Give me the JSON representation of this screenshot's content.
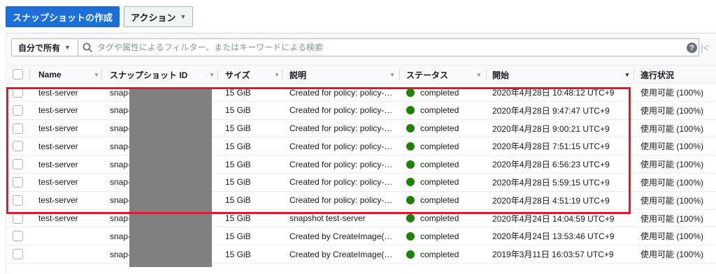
{
  "toolbar": {
    "create_label": "スナップショットの作成",
    "actions_label": "アクション"
  },
  "filter": {
    "owner_label": "自分で所有",
    "placeholder": "タグや属性によるフィルター、またはキーワードによる検索",
    "help_glyph": "?",
    "pager_glyph": "|<"
  },
  "table": {
    "headers": {
      "name": "Name",
      "snapshot_id": "スナップショット ID",
      "size": "サイズ",
      "description": "説明",
      "status": "ステータス",
      "started": "開始",
      "progress": "進行状況"
    },
    "rows": [
      {
        "name": "test-server",
        "snapshot_id": "snap-0",
        "size": "15 GiB",
        "description": "Created for policy: policy-…",
        "status": "completed",
        "started": "2020年4月28日 10:48:12 UTC+9",
        "progress": "使用可能 (100%)"
      },
      {
        "name": "test-server",
        "snapshot_id": "snap-0",
        "size": "15 GiB",
        "description": "Created for policy: policy-…",
        "status": "completed",
        "started": "2020年4月28日 9:47:47 UTC+9",
        "progress": "使用可能 (100%)"
      },
      {
        "name": "test-server",
        "snapshot_id": "snap-0",
        "size": "15 GiB",
        "description": "Created for policy: policy-…",
        "status": "completed",
        "started": "2020年4月28日 9:00:21 UTC+9",
        "progress": "使用可能 (100%)"
      },
      {
        "name": "test-server",
        "snapshot_id": "snap-0",
        "size": "15 GiB",
        "description": "Created for policy: policy-…",
        "status": "completed",
        "started": "2020年4月28日 7:51:15 UTC+9",
        "progress": "使用可能 (100%)"
      },
      {
        "name": "test-server",
        "snapshot_id": "snap-0",
        "size": "15 GiB",
        "description": "Created for policy: policy-…",
        "status": "completed",
        "started": "2020年4月28日 6:56:23 UTC+9",
        "progress": "使用可能 (100%)"
      },
      {
        "name": "test-server",
        "snapshot_id": "snap-0",
        "size": "15 GiB",
        "description": "Created for policy: policy-…",
        "status": "completed",
        "started": "2020年4月28日 5:59:15 UTC+9",
        "progress": "使用可能 (100%)"
      },
      {
        "name": "test-server",
        "snapshot_id": "snap-0",
        "size": "15 GiB",
        "description": "Created for policy: policy-…",
        "status": "completed",
        "started": "2020年4月28日 4:51:19 UTC+9",
        "progress": "使用可能 (100%)"
      },
      {
        "name": "test-server",
        "snapshot_id": "snap-0",
        "size": "15 GiB",
        "description": "snapshot test-server",
        "status": "completed",
        "started": "2020年4月24日 14:04:59 UTC+9",
        "progress": "使用可能 (100%)"
      },
      {
        "name": "",
        "snapshot_id": "snap-0",
        "size": "15 GiB",
        "description": "Created by CreateImage(…",
        "status": "completed",
        "started": "2020年4月24日 13:53:46 UTC+9",
        "progress": "使用可能 (100%)"
      },
      {
        "name": "",
        "snapshot_id": "snap-0",
        "size": "15 GiB",
        "description": "Created by CreateImage(…",
        "status": "completed",
        "started": "2019年3月11日 16:03:57 UTC+9",
        "progress": "使用可能 (100%)"
      }
    ]
  },
  "colors": {
    "primary": "#1e6fd9",
    "status_completed": "#1d8102",
    "highlight_border": "#e0182d",
    "redaction": "#808080"
  },
  "icons": {
    "caret": "chevron-down-icon",
    "search": "search-icon",
    "help": "help-icon",
    "status": "status-dot-icon",
    "pager": "first-page-icon"
  }
}
